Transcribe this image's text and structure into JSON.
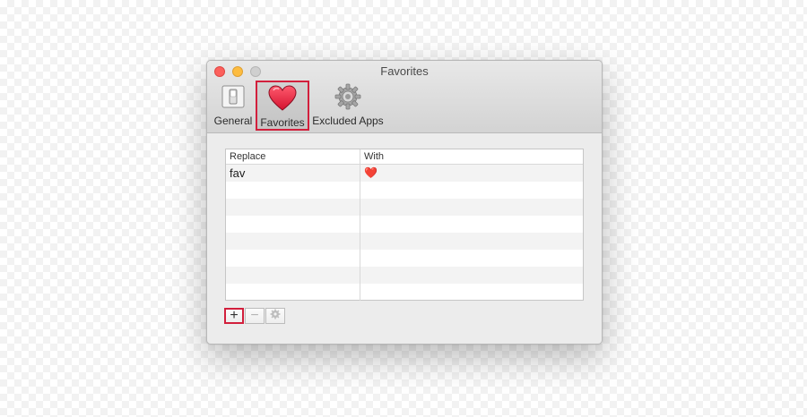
{
  "window": {
    "title": "Favorites"
  },
  "toolbar": {
    "items": [
      {
        "label": "General",
        "icon": "switch-icon"
      },
      {
        "label": "Favorites",
        "icon": "heart-icon",
        "selected": true
      },
      {
        "label": "Excluded Apps",
        "icon": "gear-icon"
      }
    ]
  },
  "table": {
    "columns": [
      "Replace",
      "With"
    ],
    "rows": [
      {
        "replace": "fav",
        "with": "❤️"
      }
    ]
  },
  "buttons": {
    "add": "+",
    "remove": "−"
  },
  "colors": {
    "highlight": "#d21f3c",
    "heart": "#e8243e"
  }
}
